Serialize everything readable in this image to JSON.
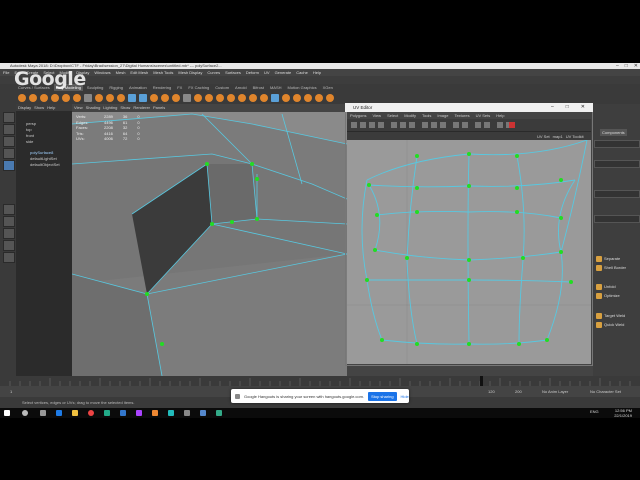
{
  "watermark": {
    "text": "Google"
  },
  "window": {
    "title": "Autodesk Maya 2018: D:\\Dropbox\\CTF - Friday\\Brad\\session_27\\Digital Humans\\scenes\\untitled.mb* --- polySurface2...",
    "controls": [
      "–",
      "□",
      "✕"
    ]
  },
  "menubar": {
    "items": [
      "File",
      "Edit",
      "Create",
      "Select",
      "Modify",
      "Display",
      "Windows",
      "Mesh",
      "Edit Mesh",
      "Mesh Tools",
      "Mesh Display",
      "Curves",
      "Surfaces",
      "Deform",
      "UV",
      "Generate",
      "Cache",
      "Help"
    ]
  },
  "shelf": {
    "tabs": [
      "Curves / Surfaces",
      "Poly Modeling",
      "Sculpting",
      "Rigging",
      "Animation",
      "Rendering",
      "FX",
      "FX Caching",
      "Custom",
      "Arnold",
      "Bifrost",
      "MASH",
      "Motion Graphics",
      "XGen"
    ],
    "active_tab": "Poly Modeling"
  },
  "outliner": {
    "tabs": [
      "Display",
      "Show",
      "Help"
    ],
    "rows": [
      "persp",
      "top",
      "front",
      "side",
      "polySurface8",
      "defaultLightSet",
      "defaultObjectSet"
    ]
  },
  "viewport": {
    "menu": [
      "View",
      "Shading",
      "Lighting",
      "Show",
      "Renderer",
      "Panels"
    ],
    "hud": [
      {
        "label": "Verts:",
        "a": "2289",
        "b": "36",
        "c": "0"
      },
      {
        "label": "Edges:",
        "a": "4496",
        "b": "61",
        "c": "0"
      },
      {
        "label": "Faces:",
        "a": "2208",
        "b": "32",
        "c": "0"
      },
      {
        "label": "Tris:",
        "a": "4416",
        "b": "64",
        "c": "0"
      },
      {
        "label": "UVs:",
        "a": "4006",
        "b": "72",
        "c": "0"
      }
    ]
  },
  "uv_editor": {
    "title": "UV Editor",
    "menu": [
      "Polygons",
      "View",
      "Select",
      "Modify",
      "Tools",
      "Image",
      "Textures",
      "UV Sets",
      "Help"
    ],
    "options": [
      "UV Set",
      "map1",
      "UV Toolkit"
    ]
  },
  "attribute_panel": {
    "items": [
      {
        "label": "Components"
      },
      {
        "label": "Separate"
      },
      {
        "label": "Shell Border"
      },
      {
        "label": "Unfold"
      },
      {
        "label": "Optimize"
      },
      {
        "label": "Target Weld"
      },
      {
        "label": "Quick Weld"
      }
    ]
  },
  "timeline": {
    "start": "1",
    "end": "120",
    "range_end": "200",
    "anim_layer": "No Anim Layer",
    "char_set": "No Character Set"
  },
  "command_line": {
    "help": "Select vertices, edges or UVs; drag to move the selected items."
  },
  "share_banner": {
    "message": "Google Hangouts is sharing your screen with hangouts.google.com.",
    "stop_label": "Stop sharing",
    "hide_label": "Hide"
  },
  "taskbar": {
    "time": "12:56 PM",
    "date": "22/1/2019",
    "lang": "ENG"
  },
  "colors": {
    "accent": "#1a73e8",
    "shelf_icon": "#e0852c",
    "wire": "#58c8e0",
    "vertex": "#22dd22"
  }
}
